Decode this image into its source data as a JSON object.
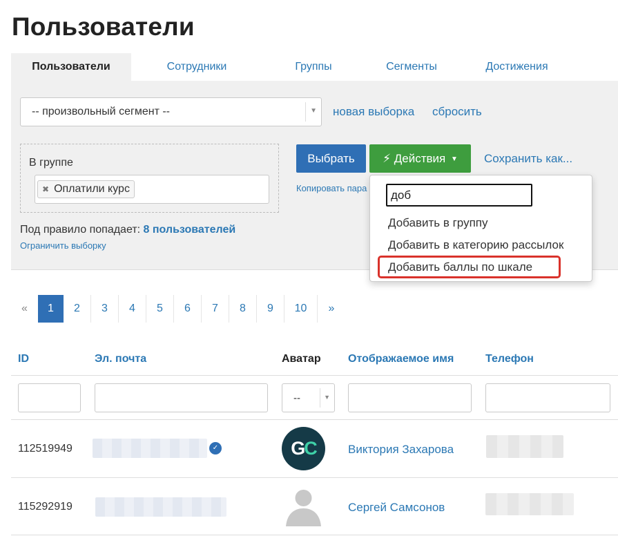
{
  "page": {
    "title": "Пользователи"
  },
  "tabs": [
    {
      "label": "Пользователи",
      "active": true
    },
    {
      "label": "Сотрудники"
    },
    {
      "label": "Группы"
    },
    {
      "label": "Сегменты"
    },
    {
      "label": "Достижения"
    }
  ],
  "filter": {
    "segment_value": "-- произвольный сегмент --",
    "new_selection_label": "новая выборка",
    "reset_label": "сбросить",
    "group_label": "В группе",
    "group_tag": "Оплатили курс",
    "select_button": "Выбрать",
    "actions_button": "Действия",
    "save_as_label": "Сохранить как...",
    "copy_params_label": "Копировать пара",
    "rule_prefix": "Под правило попадает:",
    "rule_count": "8 пользователей",
    "limit_label": "Ограничить выборку"
  },
  "actions_dropdown": {
    "search_value": "доб",
    "items": [
      "Добавить в группу",
      "Добавить в категорию рассылок",
      "Добавить баллы по шкале"
    ],
    "highlighted_index": 2,
    "highlight_color": "#d9322b"
  },
  "pagination": {
    "prev": "«",
    "pages": [
      "1",
      "2",
      "3",
      "4",
      "5",
      "6",
      "7",
      "8",
      "9",
      "10"
    ],
    "current": "1",
    "next": "»"
  },
  "table": {
    "columns": [
      "ID",
      "Эл. почта",
      "Аватар",
      "Отображаемое имя",
      "Телефон"
    ],
    "avatar_filter_value": "--",
    "rows": [
      {
        "id": "112519949",
        "name": "Виктория Захарова",
        "avatar": "GC",
        "email_verified": true
      },
      {
        "id": "115292919",
        "name": "Сергей Самсонов",
        "avatar": "default-user-icon",
        "email_verified": false
      }
    ]
  },
  "colors": {
    "link": "#2b78b4",
    "primary_button": "#2f6fb5",
    "success_button": "#3e9d3e",
    "panel_bg": "#f0f0f0"
  }
}
